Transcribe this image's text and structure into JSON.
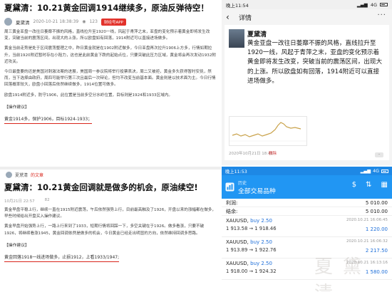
{
  "article1": {
    "title": "夏黛清：10.21黄金回调1914继续多，原油反弹待空！",
    "author": "夏黛清",
    "date": "2020-10-21 18:38:39",
    "views": "123",
    "app_button": "财经号APP",
    "paragraphs": [
      "周三黄金亚盘一改往日萎靡不振的风格，直线拉升至1920一线，风起于青萍之末，亚盘的变化预示着黄金即将发生改变，突破当前的震荡区间，出现大的上涨。所以欧盘如有回落，1914附近可以直接进场做多。",
      "黄金当前走势是处于区间震荡整理之中，昨日黄金就是在1902附近做多，今日亚盘再次拉升1906上方多，行情如期拉升，当前1920附近暂时存在小阻力，这也是此前黄金下跌的起始点位，只要突破此压力区域，黄金将会再次发动1932附近攻关。",
      "今日最重要的还是美国对刺激法案的进展，美国周一参议院将举行投票表决，周二又被拒，黄金多头获得暂时安抚，然而，当下选择由政府，周四可能举行第三次且最后一次辩论，但均不改变当前基本面。黄金则是以技术面为主。今日行情回落概率较大，欧盘小回落后依然继续做多，1914位置可做多。",
      "欧盘1914附近多，防守1906，此位置是当前多空分水岭位置，目标则是1924和1933区域内。"
    ],
    "op_head": "【操作建议】",
    "op_line": "黄金1914多，保护1906，目标1924-1933；"
  },
  "source_tag": {
    "name": "夏黛清",
    "suffix": "的文章"
  },
  "article2": {
    "title": "夏黛清：10.21黄金回调就是做多的机会，原油续空!",
    "date": "10月21日 22:57",
    "views": "82",
    "paragraphs": [
      "黄金早盘平稳上行，继续一直在1915附近震荡，午后依然强势上行，目前最高触及了1926，开盘以来的涨幅都在做多，早些时候给出开盘买入操作建议。",
      "黄金早盘开始强势上行，一路上行来到了1933，短期行情将回踩一下，多空关键在于1926。做多看涨，只要不破1926，将继续看涨1945，黄金回调依然是做多的机会，今日黄金已经走出明显的方向，依然维持回调多思路。"
    ],
    "op_head": "【操作建议】",
    "op_line": "黄金回落1918一线进场做多，止损1912，上看1933/1947;"
  },
  "phone1": {
    "status_time": "晚上11:54",
    "status_right": "4G",
    "nav_title": "详情",
    "author": "夏黛清",
    "body": "黄金亚盘一改往日萎靡不振的风格，直线拉升至1920一线，风起于青萍之末，亚盘的变化预示着黄金即将发生改变，突破当前的震荡区间，出现大的上涨。所以欧盘如有回落，1914附近可以直接进场做多。",
    "date": "2020年10月21日 18:41",
    "delete_label": "删除",
    "dots": "··"
  },
  "phone2": {
    "status_time": "晚上11:53",
    "status_right": "4G",
    "header_sub": "历史",
    "header_title": "全部交易品种",
    "summary": [
      {
        "label": "利润:",
        "value": "5 010.00"
      },
      {
        "label": "结余:",
        "value": "5 010.00"
      }
    ],
    "trades": [
      {
        "symbol": "XAUUSD,",
        "side": "buy 2.50",
        "prices": "1 913.58 → 1 918.46",
        "date": "2020.10.21 16:06:45",
        "profit": "1 220.00"
      },
      {
        "symbol": "XAUUSD,",
        "side": "buy 2.50",
        "prices": "1 913.89 → 1 922.76",
        "date": "2020.10.21 16:06:32",
        "profit": "2 217.50"
      },
      {
        "symbol": "XAUUSD,",
        "side": "buy 2.50",
        "prices": "1 918.00 → 1 924.32",
        "date": "2020.10.21 16:13:16",
        "profit": "1 580.00"
      }
    ],
    "watermark": "夏黛清"
  },
  "colors": {
    "accent_red": "#d9261c",
    "mt4_blue": "#2196f3",
    "profit_blue": "#1e6fd9"
  }
}
